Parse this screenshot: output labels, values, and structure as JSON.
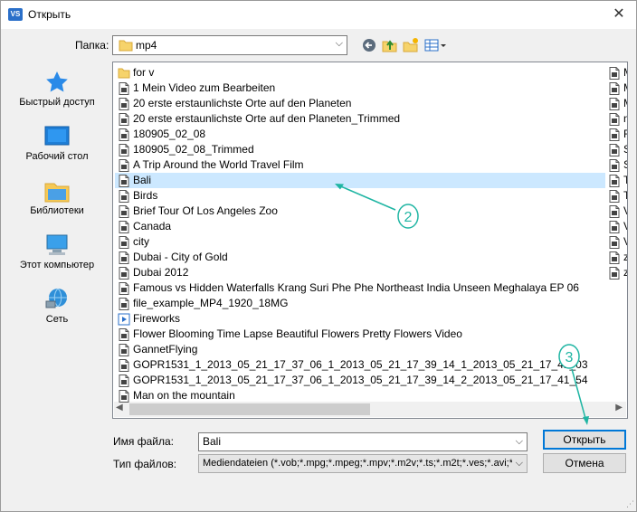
{
  "window": {
    "title": "Открыть",
    "app_icon": "VS",
    "close_glyph": "✕"
  },
  "lookin": {
    "label": "Папка:",
    "value": "mp4"
  },
  "toolbar": {
    "icons": [
      "back-icon",
      "up-folder-icon",
      "new-folder-icon",
      "view-menu-icon"
    ]
  },
  "places": [
    {
      "label": "Быстрый доступ",
      "icon": "star-icon"
    },
    {
      "label": "Рабочий стол",
      "icon": "desktop-icon"
    },
    {
      "label": "Библиотеки",
      "icon": "libraries-icon"
    },
    {
      "label": "Этот компьютер",
      "icon": "computer-icon"
    },
    {
      "label": "Сеть",
      "icon": "network-icon"
    }
  ],
  "files": [
    {
      "name": "for v",
      "type": "folder"
    },
    {
      "name": "1 Mein Video zum Bearbeiten",
      "type": "file"
    },
    {
      "name": "20 erste erstaunlichste Orte auf den Planeten",
      "type": "file"
    },
    {
      "name": "20 erste erstaunlichste Orte auf den Planeten_Trimmed",
      "type": "file"
    },
    {
      "name": "180905_02_08",
      "type": "file"
    },
    {
      "name": "180905_02_08_Trimmed",
      "type": "file"
    },
    {
      "name": "A Trip Around the World Travel Film",
      "type": "file"
    },
    {
      "name": "Bali",
      "type": "file",
      "selected": true
    },
    {
      "name": "Birds",
      "type": "file"
    },
    {
      "name": "Brief Tour Of Los Angeles Zoo",
      "type": "file"
    },
    {
      "name": "Canada",
      "type": "file"
    },
    {
      "name": "city",
      "type": "file"
    },
    {
      "name": "Dubai - City of Gold",
      "type": "file"
    },
    {
      "name": "Dubai 2012",
      "type": "file"
    },
    {
      "name": "Famous vs Hidden Waterfalls Krang Suri Phe Phe Northeast India Unseen Meghalaya EP 06",
      "type": "file"
    },
    {
      "name": "file_example_MP4_1920_18MG",
      "type": "file"
    },
    {
      "name": "Fireworks",
      "type": "video"
    },
    {
      "name": "Flower Blooming Time Lapse Beautiful Flowers Pretty Flowers Video",
      "type": "file"
    },
    {
      "name": "GannetFlying",
      "type": "file"
    },
    {
      "name": "GOPR1531_1_2013_05_21_17_37_06_1_2013_05_21_17_39_14_1_2013_05_21_17_41_03",
      "type": "file"
    },
    {
      "name": "GOPR1531_1_2013_05_21_17_37_06_1_2013_05_21_17_39_14_2_2013_05_21_17_41_54",
      "type": "file"
    },
    {
      "name": "Man on the mountain",
      "type": "file"
    }
  ],
  "files_col2": [
    "M",
    "M",
    "M",
    "n",
    "R",
    "S",
    "S",
    "T",
    "T",
    "V",
    "V",
    "V",
    "z",
    "z"
  ],
  "filename": {
    "label": "Имя файла:",
    "value": "Bali"
  },
  "filetype": {
    "label": "Тип файлов:",
    "value": "Mediendateien (*.vob;*.mpg;*.mpeg;*.mpv;*.m2v;*.ts;*.m2t;*.ves;*.avi;*.a"
  },
  "buttons": {
    "open": "Открыть",
    "cancel": "Отмена"
  },
  "annotations": [
    {
      "label": "2"
    },
    {
      "label": "3"
    }
  ],
  "colors": {
    "selection": "#cce8ff",
    "accent": "#0078d7",
    "annotation": "#1fb5a3"
  }
}
